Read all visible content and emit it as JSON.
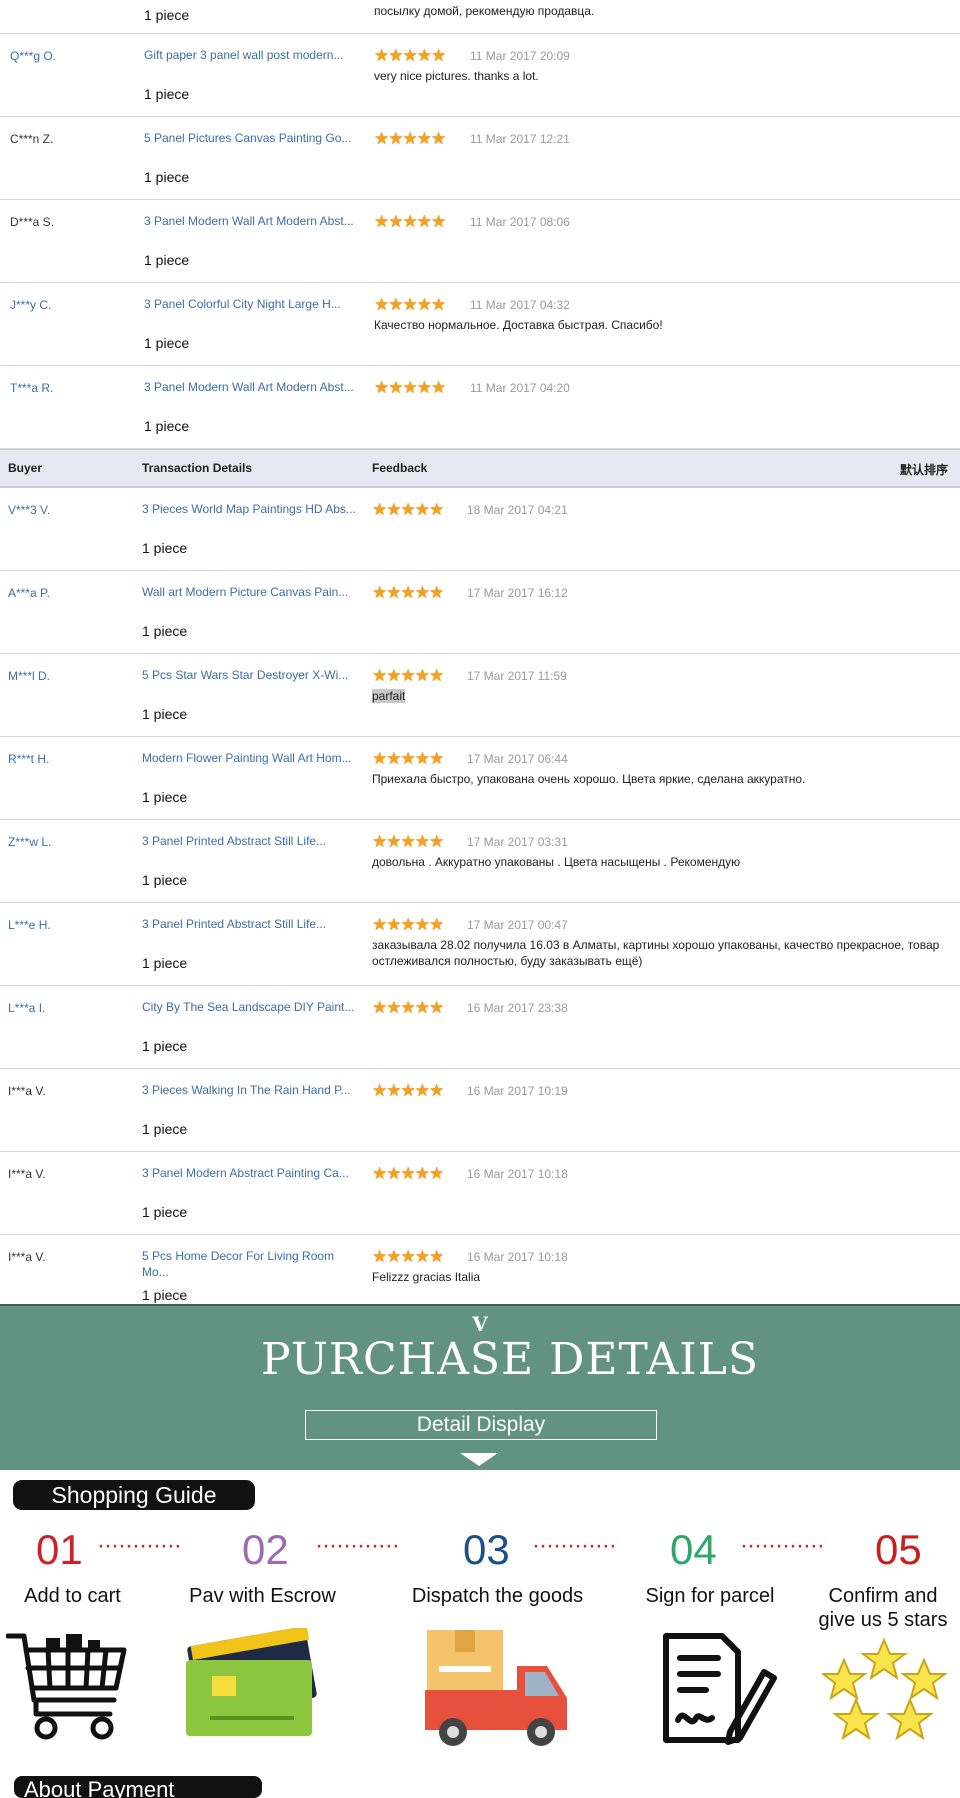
{
  "section1": {
    "top_row": {
      "qty": "1 piece",
      "feedback": "посылку домой, рекомендую продавца."
    },
    "rows": [
      {
        "buyer": "Q***g O.",
        "item": "Gift paper 3 panel wall post modern...",
        "stars": "★★★★★",
        "date": "11 Mar 2017 20:09",
        "feedback": "very nice pictures. thanks a lot.",
        "qty": "1 piece"
      },
      {
        "buyer": "C***n Z.",
        "item": "5 Panel Pictures Canvas Painting Go...",
        "stars": "★★★★★",
        "date": "11 Mar 2017 12:21",
        "feedback": "",
        "qty": "1 piece"
      },
      {
        "buyer": "D***a S.",
        "item": "3 Panel Modern Wall Art Modern Abst...",
        "stars": "★★★★★",
        "date": "11 Mar 2017 08:06",
        "feedback": "",
        "qty": "1 piece"
      },
      {
        "buyer": "J***y C.",
        "item": "3 Panel Colorful City Night Large H...",
        "stars": "★★★★★",
        "date": "11 Mar 2017 04:32",
        "feedback": "Качество нормальное. Доставка быстрая. Спасибо!",
        "qty": "1 piece"
      },
      {
        "buyer": "T***a R.",
        "item": "3 Panel Modern Wall Art Modern Abst...",
        "stars": "★★★★★",
        "date": "11 Mar 2017 04:20",
        "feedback": "",
        "qty": "1 piece"
      }
    ]
  },
  "table_header": {
    "buyer": "Buyer",
    "transaction": "Transaction Details",
    "feedback": "Feedback",
    "sort": "默认排序"
  },
  "section2": {
    "rows": [
      {
        "buyer": "V***3 V.",
        "item": "3 Pieces World Map Paintings HD Abs...",
        "stars": "★★★★★",
        "date": "18 Mar 2017 04:21",
        "feedback": "",
        "qty": "1 piece"
      },
      {
        "buyer": "A***a P.",
        "item": "Wall art Modern Picture Canvas Pain...",
        "stars": "★★★★★",
        "date": "17 Mar 2017 16:12",
        "feedback": "",
        "qty": "1 piece"
      },
      {
        "buyer": "M***l D.",
        "item": "5 Pcs Star Wars Star Destroyer X-Wi...",
        "stars": "★★★★★",
        "date": "17 Mar 2017 11:59",
        "feedback": "parfait",
        "qty": "1 piece"
      },
      {
        "buyer": "R***t H.",
        "item": "Modern Flower Painting Wall Art Hom...",
        "stars": "★★★★★",
        "date": "17 Mar 2017 06:44",
        "feedback": "Приехала быстро, упакована очень хорошо. Цвета яркие, сделана аккуратно.",
        "qty": "1 piece"
      },
      {
        "buyer": "Z***w L.",
        "item": "3 Panel Printed Abstract Still Life...",
        "stars": "★★★★★",
        "date": "17 Mar 2017 03:31",
        "feedback": "довольна . Аккуратно упакованы . Цвета насыщены . Рекомендую",
        "qty": "1 piece"
      },
      {
        "buyer": "L***e H.",
        "item": "3 Panel Printed Abstract Still Life...",
        "stars": "★★★★★",
        "date": "17 Mar 2017 00:47",
        "feedback": "заказывала 28.02 получила 16.03 в Алматы, картины хорошо упакованы, качество прекрасное, товар остлеживался полностью, буду заказывать ещё)",
        "qty": "1 piece"
      },
      {
        "buyer": "L***a I.",
        "item": "City By The Sea Landscape DIY Paint...",
        "stars": "★★★★★",
        "date": "16 Mar 2017 23:38",
        "feedback": "",
        "qty": "1 piece"
      },
      {
        "buyer": "I***a V.",
        "item": "3 Pieces Walking In The Rain Hand P...",
        "stars": "★★★★★",
        "date": "16 Mar 2017 10:19",
        "feedback": "",
        "qty": "1 piece"
      },
      {
        "buyer": "I***a V.",
        "item": "3 Panel Modern Abstract Painting Ca...",
        "stars": "★★★★★",
        "date": "16 Mar 2017 10:18",
        "feedback": "",
        "qty": "1 piece"
      },
      {
        "buyer": "I***a V.",
        "item": "5 Pcs Home Decor For Living Room Mo...",
        "stars": "★★★★★",
        "date": "16 Mar 2017 10:18",
        "feedback": "Felizzz gracias Italia",
        "qty": "1 piece"
      }
    ]
  },
  "banner": {
    "v": "V",
    "title": "PURCHASE DETAILS",
    "button": "Detail Display"
  },
  "guide": {
    "badge": "Shopping Guide",
    "dots": "············",
    "steps": [
      {
        "num": "01",
        "label": "Add to cart",
        "color": "#d0202a"
      },
      {
        "num": "02",
        "label": "Pav with Escrow",
        "color": "#9b6bb0"
      },
      {
        "num": "03",
        "label": "Dispatch the goods",
        "color": "#1f4f8a"
      },
      {
        "num": "04",
        "label": "Sign for parcel",
        "color": "#2ca86b"
      },
      {
        "num": "05",
        "label": "Confirm and give us 5 stars",
        "color": "#c81e1e"
      }
    ]
  },
  "about": {
    "label": "About Payment"
  }
}
